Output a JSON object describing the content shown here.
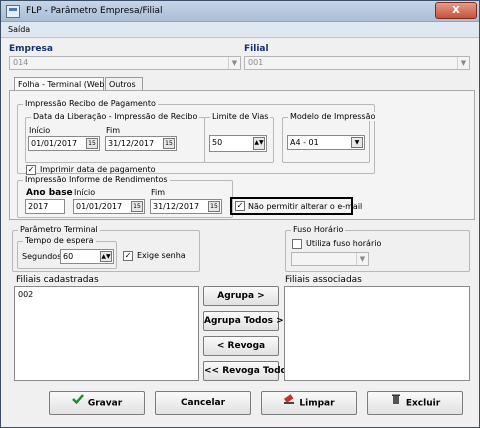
{
  "window": {
    "title": "FLP - Parâmetro Empresa/Filial",
    "close_label": "X"
  },
  "menu": {
    "items": [
      "Saída"
    ]
  },
  "empresa": {
    "label": "Empresa",
    "value": "014"
  },
  "filial": {
    "label": "Filial",
    "value": "001"
  },
  "tabs": [
    {
      "label": "Folha - Terminal (Web)",
      "active": true
    },
    {
      "label": "Outros",
      "active": false
    }
  ],
  "recibo": {
    "title": "Impressão Recibo de Pagamento",
    "liberacao": {
      "title": "Data da Liberação - Impressão de Recibo",
      "inicio_label": "Início",
      "inicio_value": "01/01/2017",
      "fim_label": "Fim",
      "fim_value": "31/12/2017"
    },
    "limite": {
      "title": "Limite de Vias",
      "value": "50"
    },
    "modelo": {
      "title": "Modelo de Impressão",
      "value": "A4 - 01"
    },
    "imprimir_data": {
      "label": "Imprimir data de pagamento",
      "checked": true
    }
  },
  "informe": {
    "title": "Impressão Informe de Rendimentos",
    "ano_base_label": "Ano base",
    "ano_base_value": "2017",
    "inicio_label": "Início",
    "inicio_value": "01/01/2017",
    "fim_label": "Fim",
    "fim_value": "31/12/2017"
  },
  "nao_permitir_email": {
    "label": "Não permitir alterar o e-mail",
    "checked": true
  },
  "terminal": {
    "title": "Parâmetro Terminal",
    "tempo_title": "Tempo de espera",
    "segundos_label": "Segundos",
    "segundos_value": "60",
    "exige_senha": {
      "label": "Exige senha",
      "checked": true
    }
  },
  "fuso": {
    "title": "Fuso Horário",
    "utiliza_label": "Utiliza fuso horário",
    "checked": false,
    "select_value": ""
  },
  "filiais_cadastradas": {
    "label": "Filiais cadastradas",
    "items": [
      "002"
    ]
  },
  "filiais_associadas": {
    "label": "Filiais associadas",
    "items": []
  },
  "transfer": {
    "agrupa": "Agrupa >",
    "agrupa_todos": "Agrupa Todos >>",
    "revoga": "< Revoga",
    "revoga_todos": "<< Revoga Todos"
  },
  "footer": {
    "gravar": "Gravar",
    "cancelar": "Cancelar",
    "limpar": "Limpar",
    "excluir": "Excluir"
  },
  "icons": {
    "calendar": "calendar-icon",
    "dropdown": "chevron-down-icon",
    "check": "check-icon"
  },
  "colors": {
    "label_blue": "#16306e",
    "title_bar": "#a9bdd6"
  }
}
